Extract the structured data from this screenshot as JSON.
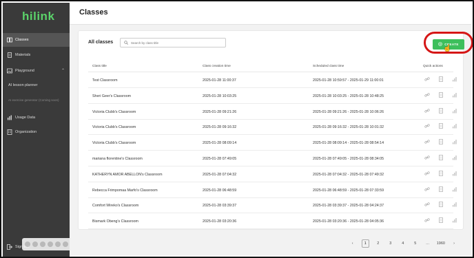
{
  "app": {
    "logo": "hilink",
    "page_title": "Classes"
  },
  "sidebar": {
    "items": [
      {
        "label": "Classes",
        "icon": "book-icon",
        "active": true
      },
      {
        "label": "Materials",
        "icon": "document-icon"
      },
      {
        "label": "Playground",
        "icon": "image-icon"
      },
      {
        "label": "AI lesson planner",
        "icon": ""
      },
      {
        "label": "AI exercise generator (Coming soon)",
        "icon": ""
      },
      {
        "label": "Usage Data",
        "icon": "bar-chart-icon"
      },
      {
        "label": "Organization",
        "icon": "building-icon"
      }
    ],
    "signout_label": "Sign out"
  },
  "classes": {
    "title": "All classes",
    "search_placeholder": "Search by class title",
    "create_label": "CREATE",
    "columns": [
      "Class title",
      "Class creation time",
      "Scheduled class time",
      "Quick actions"
    ],
    "rows": [
      {
        "title": "Test Classroom",
        "created": "2025-01-28 11:00:37",
        "scheduled": "2025-01-28 10:59:57 - 2025-01-29 11:00:01"
      },
      {
        "title": "Sheri Geer's Classroom",
        "created": "2025-01-28 10:03:25",
        "scheduled": "2025-01-28 10:03:25 - 2025-01-28 10:48:25"
      },
      {
        "title": "Victoria Clubb's Classroom",
        "created": "2025-01-28 09:21:26",
        "scheduled": "2025-01-28 09:21:26 - 2025-01-28 10:06:26"
      },
      {
        "title": "Victoria Clubb's Classroom",
        "created": "2025-01-28 09:16:32",
        "scheduled": "2025-01-28 09:16:32 - 2025-01-28 10:01:32"
      },
      {
        "title": "Victoria Clubb's Classroom",
        "created": "2025-01-28 08:09:14",
        "scheduled": "2025-01-28 08:09:14 - 2025-01-28 08:54:14"
      },
      {
        "title": "mariana florentine's Classroom",
        "created": "2025-01-28 07:49:05",
        "scheduled": "2025-01-28 07:49:05 - 2025-01-28 08:34:05"
      },
      {
        "title": "KATHERYN AMOR ABELLON's Classroom",
        "created": "2025-01-28 07:04:32",
        "scheduled": "2025-01-28 07:04:32 - 2025-01-28 07:49:32"
      },
      {
        "title": "Rebecca Frimpomaa Marfo's Classroom",
        "created": "2025-01-28 06:48:59",
        "scheduled": "2025-01-28 06:48:59 - 2025-01-28 07:33:59"
      },
      {
        "title": "Comfort Wireko's Classroom",
        "created": "2025-01-28 03:39:37",
        "scheduled": "2025-01-28 03:39:37 - 2025-01-28 04:24:37"
      },
      {
        "title": "Bismark Obeng's Classroom",
        "created": "2025-01-28 03:20:36",
        "scheduled": "2025-01-28 03:20:36 - 2025-01-28 04:05:36"
      }
    ]
  },
  "pagination": {
    "pages": [
      "1",
      "2",
      "3",
      "4",
      "5",
      "…",
      "1960"
    ],
    "current": "1",
    "prev": "‹",
    "next": "›"
  },
  "colors": {
    "brand": "#5bd36a",
    "create": "#3dbf5c",
    "sidebar_bg": "#3a3a3a",
    "highlight": "#d51616"
  }
}
